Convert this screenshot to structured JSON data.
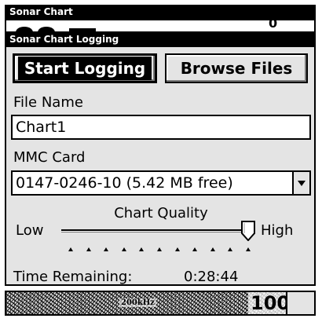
{
  "background_window": {
    "title": "Sonar Chart",
    "depth_fragment": "0"
  },
  "dialog": {
    "title": "Sonar Chart Logging",
    "buttons": {
      "start_logging": "Start Logging",
      "browse_files": "Browse Files"
    },
    "file_name": {
      "label": "File Name",
      "value": "Chart1"
    },
    "mmc_card": {
      "label": "MMC Card",
      "selected": "0147-0246-10 (5.42 MB free)"
    },
    "chart_quality": {
      "label": "Chart Quality",
      "low_label": "Low",
      "high_label": "High",
      "level_fraction": 1.0,
      "tick_count": 11
    },
    "time_remaining": {
      "label": "Time Remaining:",
      "value": "0:28:44"
    }
  },
  "status_bar": {
    "frequency": "200kHz",
    "depth": "100"
  }
}
